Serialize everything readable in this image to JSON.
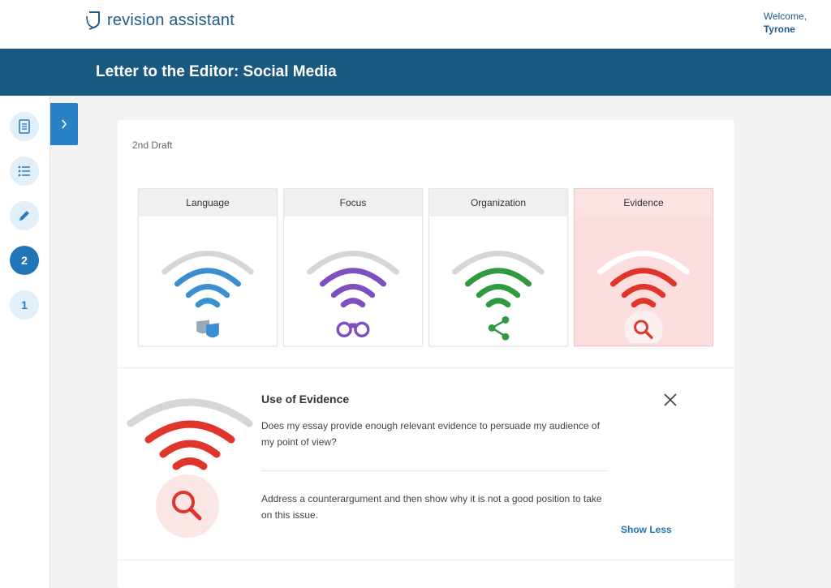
{
  "header": {
    "logo_text": "revision assistant",
    "welcome_label": "Welcome,",
    "user_name": "Tyrone"
  },
  "title_bar": {
    "title": "Letter to the Editor: Social Media"
  },
  "left_rail": {
    "items": [
      {
        "icon": "document-icon"
      },
      {
        "icon": "list-icon"
      },
      {
        "icon": "pencil-icon"
      },
      {
        "label": "2",
        "active": true
      },
      {
        "label": "1",
        "active": false
      }
    ],
    "toggle_icon": "chevron-right-icon"
  },
  "draft": {
    "label": "2nd Draft"
  },
  "traits": [
    {
      "label": "Language",
      "color": "#3a8fd0",
      "icon": "masks-icon",
      "selected": false
    },
    {
      "label": "Focus",
      "color": "#7d4fc1",
      "icon": "binoculars-icon",
      "selected": false
    },
    {
      "label": "Organization",
      "color": "#2f9a3f",
      "icon": "share-nodes-icon",
      "selected": false
    },
    {
      "label": "Evidence",
      "color": "#e0352b",
      "icon": "magnifier-icon",
      "selected": true
    }
  ],
  "detail": {
    "title": "Use of Evidence",
    "question": "Does my essay provide enough relevant evidence to persuade my audience of my point of view?",
    "tip": "Address a counterargument and then show why it is not a good position to take on this issue.",
    "show_less_label": "Show Less",
    "color": "#e0352b"
  }
}
